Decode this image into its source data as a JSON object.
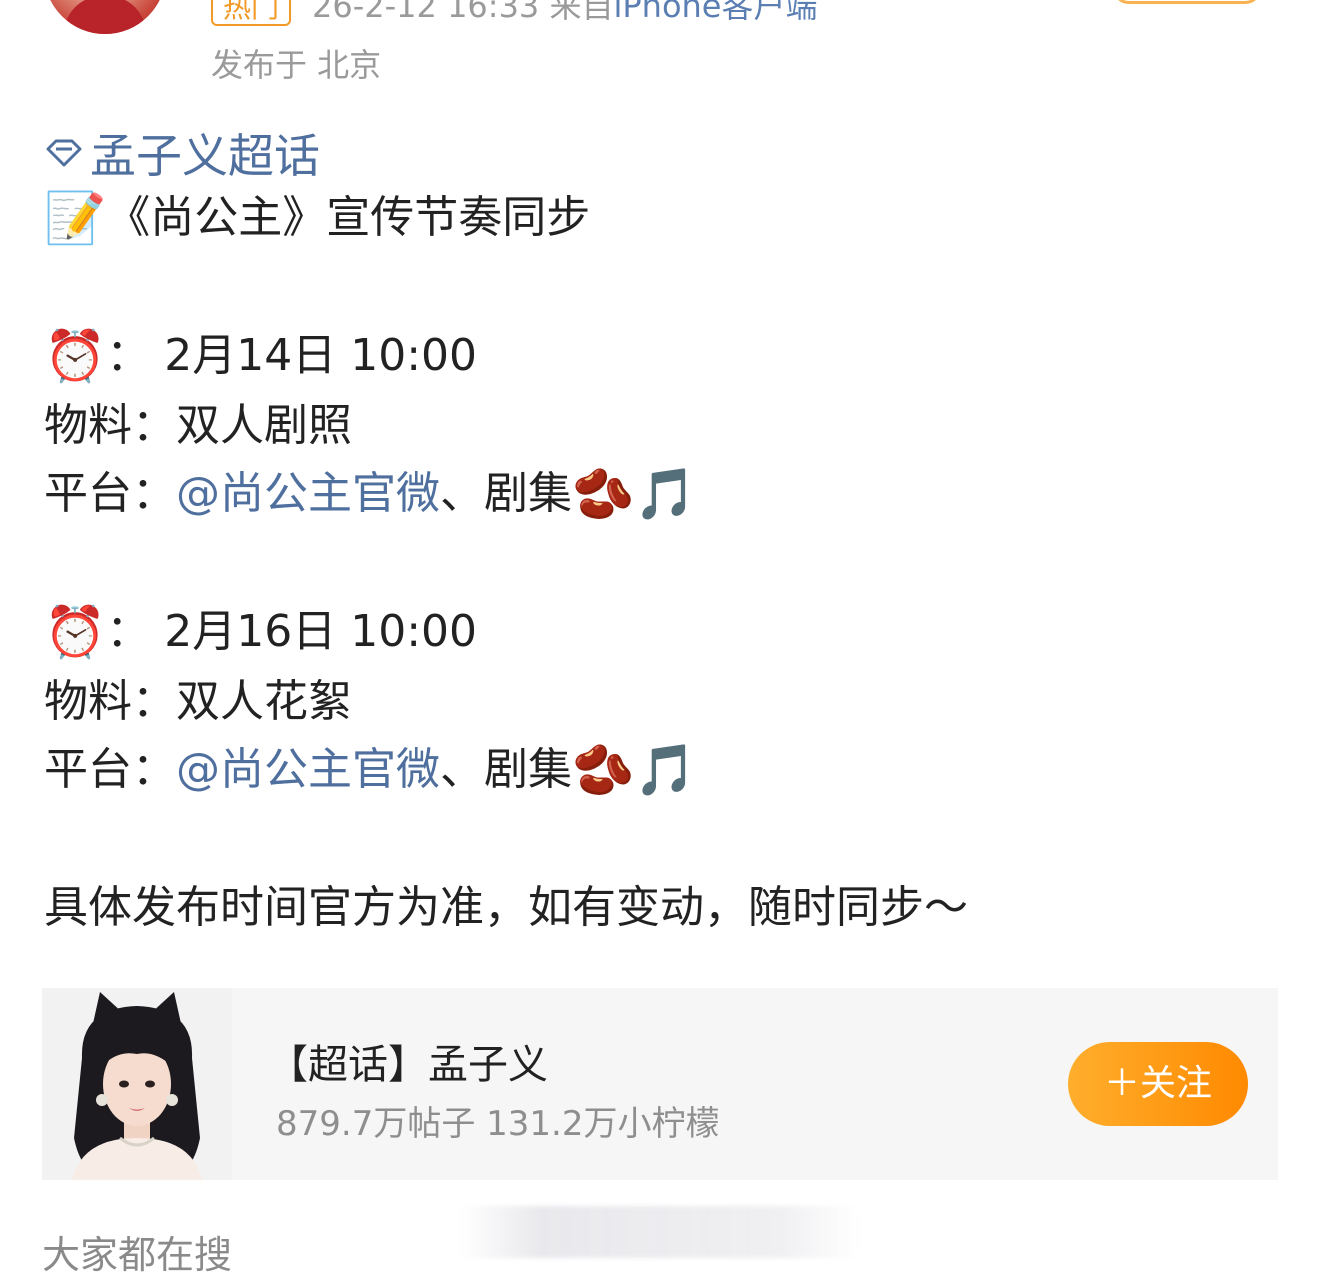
{
  "header": {
    "badge": "热门",
    "timestamp": "26-2-12 16:33",
    "source_prefix": "来自",
    "source_client": "iPhone客户端",
    "location": "发布于 北京"
  },
  "post": {
    "topic": "孟子义超话",
    "topic_icon": "diamond-icon",
    "headline_emoji": "📝",
    "headline": "《尚公主》宣传节奏同步",
    "schedules": [
      {
        "time_emoji": "⏰",
        "time_text": "： 2月14日 10:00",
        "material_label": "物料：",
        "material": "双人剧照",
        "platform_label": "平台：",
        "platform_mention": "@尚公主官微",
        "platform_rest": " 、剧集",
        "platform_emojis": "🫘🎵"
      },
      {
        "time_emoji": "⏰",
        "time_text": "： 2月16日 10:00",
        "material_label": "物料：",
        "material": "双人花絮",
        "platform_label": "平台：",
        "platform_mention": "@尚公主官微",
        "platform_rest": "、剧集",
        "platform_emojis": "🫘🎵"
      }
    ],
    "note": "具体发布时间官方为准，如有变动，随时同步～"
  },
  "card": {
    "title": "【超话】孟子义",
    "stats": "879.7万帖子 131.2万小柠檬",
    "follow_label": "＋关注"
  },
  "bottom": {
    "search_label": "大家都在搜"
  },
  "colors": {
    "link": "#4f6f9e",
    "accent": "#ff8a00",
    "meta": "#9a9a9a"
  }
}
